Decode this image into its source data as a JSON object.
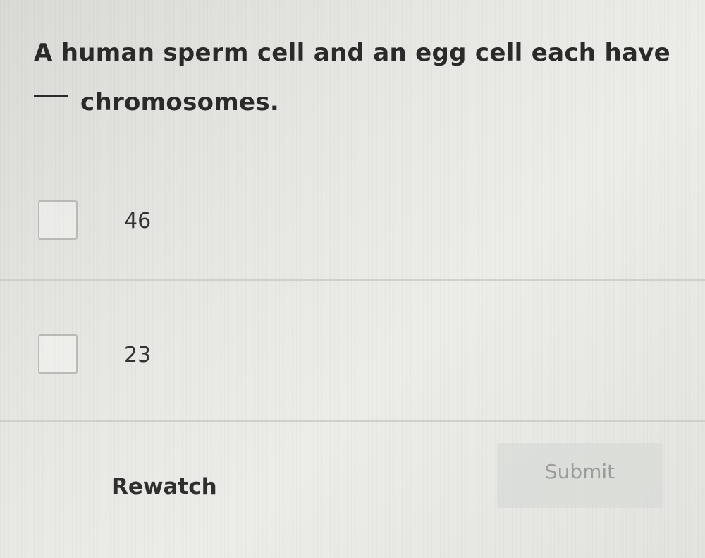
{
  "question": {
    "line1": "A human sperm cell and an egg cell each have",
    "line2": "chromosomes."
  },
  "options": [
    {
      "label": "46",
      "checked": false
    },
    {
      "label": "23",
      "checked": false
    }
  ],
  "actions": {
    "rewatch_label": "Rewatch",
    "submit_label": "Submit"
  },
  "colors": {
    "background": "#e6e6e2",
    "text": "#2b2b2b",
    "submit_disabled_text": "#9c9c9a"
  }
}
